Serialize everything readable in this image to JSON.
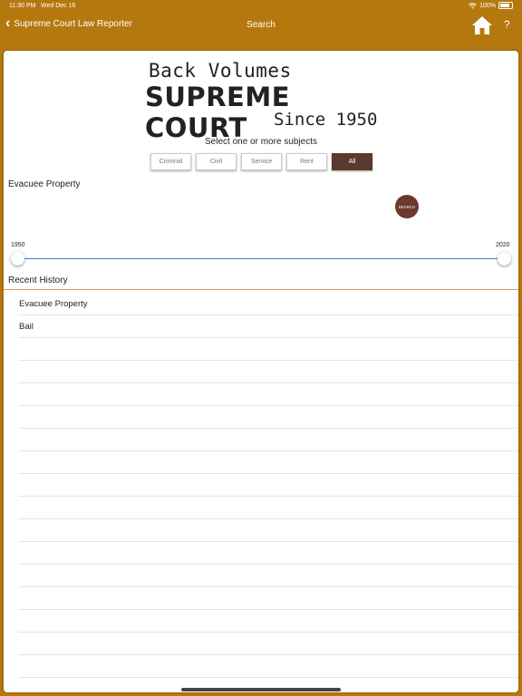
{
  "status": {
    "time": "11:30 PM",
    "date": "Wed Dec 16",
    "battery": "100%"
  },
  "nav": {
    "back_label": "Supreme Court Law Reporter",
    "title": "Search",
    "help": "?"
  },
  "logo": {
    "line1": "Back Volumes",
    "line2": "SUPREME COURT",
    "line3": "Since 1950"
  },
  "subjects": {
    "label": "Select one or more subjects",
    "chips": [
      "Criminal",
      "Civil",
      "Service",
      "Rent",
      "All"
    ],
    "selected": "All"
  },
  "search": {
    "query": "Evacuee Property",
    "button": "SEARCH"
  },
  "year_range": {
    "min": "1950",
    "max": "2020"
  },
  "history": {
    "title": "Recent History",
    "items": [
      "Evacuee Property",
      "Bail",
      "",
      "",
      "",
      "",
      "",
      "",
      "",
      "",
      "",
      "",
      "",
      "",
      "",
      "",
      "",
      ""
    ]
  },
  "colors": {
    "header": "#b5780f",
    "accent": "#5a3a2e",
    "slider": "#2f80d8"
  }
}
